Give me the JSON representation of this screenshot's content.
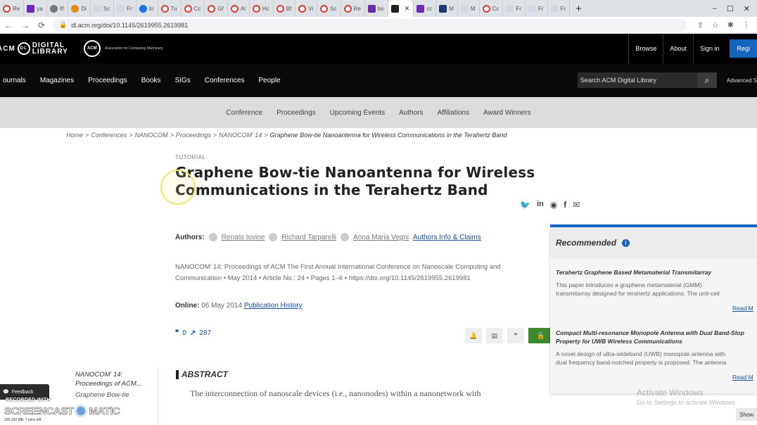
{
  "browser": {
    "tabs": [
      {
        "icon": "acm-icon",
        "label": "Re"
      },
      {
        "icon": "purple-icon",
        "label": "ya"
      },
      {
        "icon": "gray-icon",
        "label": "If!"
      },
      {
        "icon": "orange-icon",
        "label": "Di"
      },
      {
        "icon": "light-icon",
        "label": "Sc"
      },
      {
        "icon": "light-icon",
        "label": "Fr"
      },
      {
        "icon": "blue-icon",
        "label": "In"
      },
      {
        "icon": "acm-icon",
        "label": "Tu"
      },
      {
        "icon": "acm-icon",
        "label": "Cc"
      },
      {
        "icon": "acm-icon",
        "label": "Gf"
      },
      {
        "icon": "acm-icon",
        "label": "Al"
      },
      {
        "icon": "acm-icon",
        "label": "Hc"
      },
      {
        "icon": "acm-icon",
        "label": "Bf"
      },
      {
        "icon": "acm-icon",
        "label": "Vi"
      },
      {
        "icon": "acm-icon",
        "label": "Sc"
      },
      {
        "icon": "acm-icon",
        "label": "Re"
      },
      {
        "icon": "purple-icon",
        "label": "bo"
      },
      {
        "icon": "black-icon",
        "label": ""
      },
      {
        "icon": "purple-icon",
        "label": "cc"
      },
      {
        "icon": "navy-icon",
        "label": "M"
      },
      {
        "icon": "light-icon",
        "label": "M"
      },
      {
        "icon": "acm-icon",
        "label": "Cc"
      },
      {
        "icon": "light-icon",
        "label": "Fr"
      },
      {
        "icon": "light-icon",
        "label": "Fr"
      },
      {
        "icon": "light-icon",
        "label": "Fr"
      }
    ],
    "active_close": "✕",
    "new_tab": "+",
    "url": "dl.acm.org/doi/10.1145/2619955.2619981"
  },
  "header": {
    "logo_acm": "ACM",
    "logo_text1": "DIGITAL",
    "logo_text2": "LIBRARY",
    "assoc_mark": "ACM",
    "assoc_text": "Association for Computing Machinery",
    "links": [
      "Browse",
      "About",
      "Sign in"
    ],
    "register": "Regi"
  },
  "mainnav": {
    "items": [
      "ournals",
      "Magazines",
      "Proceedings",
      "Books",
      "SIGs",
      "Conferences",
      "People"
    ],
    "search_placeholder": "Search ACM Digital Library",
    "advanced": "Advanced S"
  },
  "subnav": {
    "items": [
      "Conference",
      "Proceedings",
      "Upcoming Events",
      "Authors",
      "Affiliations",
      "Award Winners"
    ]
  },
  "breadcrumb": {
    "items": [
      "Home",
      "Conferences",
      "NANOCOM",
      "Proceedings",
      "NANOCOM' 14"
    ],
    "current": "Graphene Bow-tie Nanoantenna for Wireless Communications in the Terahertz Band",
    "separator": ">"
  },
  "article": {
    "type": "TUTORIAL",
    "title": "Graphene Bow-tie Nanoantenna for Wireless Communications in the Terahertz Band",
    "authors_label": "Authors:",
    "authors": [
      "Renato Iovine",
      "Richard Tarparelli",
      "Anna Maria Vegni"
    ],
    "authors_claims": "Authors Info & Claims",
    "pubinfo": "NANOCOM' 14: Proceedings of ACM The First Annual International Conference on Nanoscale Computing and Communication • May 2014 • Article No.: 24 • Pages 1–6 • https://doi.org/10.1145/2619955.2619981",
    "online_label": "Online:",
    "online_date": "06 May 2014",
    "publication_history": "Publication History",
    "citations": "0",
    "downloads": "287",
    "sidebar_title": "NANOCOM' 14: Proceedings of ACM...",
    "sidebar_sub": "Graphene Bow-tie",
    "abstract_heading": "ABSTRACT",
    "abstract_text": "The interconnection of nanoscale devices (i.e., nanonodes) within a nanonetwork with"
  },
  "recommended": {
    "heading": "Recommended",
    "items": [
      {
        "title": "Terahertz Graphene Based Metamaterial Transmitarray",
        "desc1": "This paper introduces a graphene metamaterial (GMM)",
        "desc2": "transmitarray designed for terahertz applications. The unit-cell",
        "more": "Read M"
      },
      {
        "title": "Compact Multi-resonance Monopole Antenna with Dual Band-Stop",
        "title2": "Property for UWB Wireless Communications",
        "desc1": "A novel design of ultra-wideband (UWB) monopole antenna with",
        "desc2": "dual frequency band-notched property is proposed. The antenna",
        "more": "Read M"
      }
    ]
  },
  "overlays": {
    "activate_title": "Activate Windows",
    "activate_sub": "Go to Settings to activate Windows.",
    "show": "Show",
    "feedback": "Feedback",
    "recorded": "RECORDED WITH",
    "brand_left": "SCREENCAST",
    "brand_right": "MATIC",
    "size_info": "192,192 MB, 7 mins left"
  },
  "colors": {
    "accent": "#1565c0",
    "header_bg": "#000000",
    "subnav_bg": "#dcdcdc",
    "pdf_green": "#3d8a2a"
  }
}
